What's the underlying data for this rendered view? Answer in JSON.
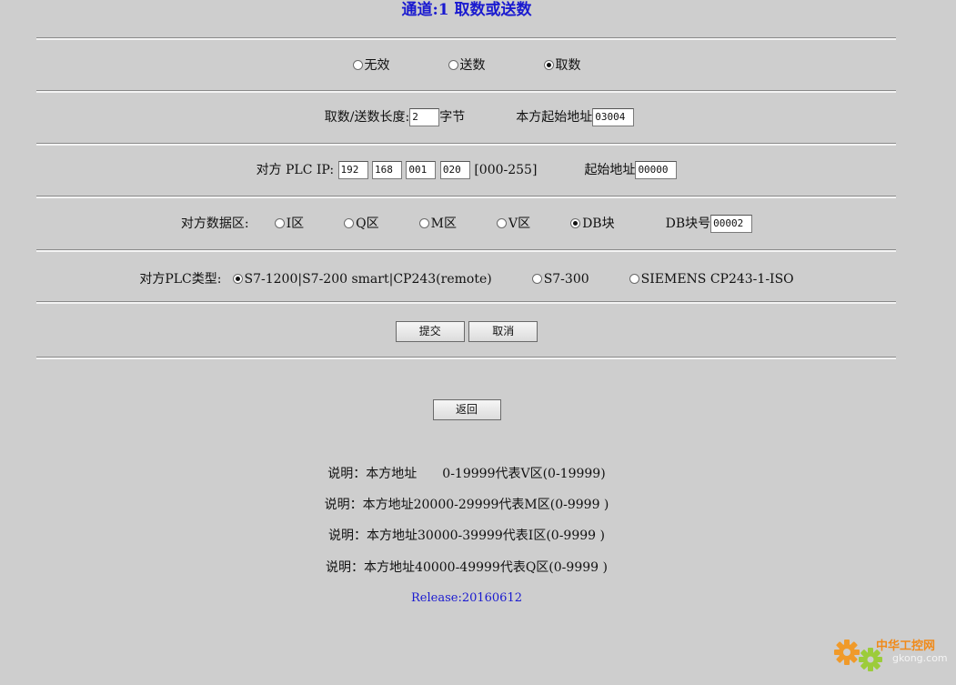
{
  "title": "通道:1 取数或送数",
  "mode": {
    "options": [
      "无效",
      "送数",
      "取数"
    ],
    "selected": "取数"
  },
  "length": {
    "label": "取数/送数长度:",
    "value": "2",
    "unit": "字节",
    "local_addr_label": "本方起始地址",
    "local_addr_value": "03004"
  },
  "ip": {
    "label": "对方 PLC IP:",
    "octets": [
      "192",
      "168",
      "001",
      "020"
    ],
    "range": "[000-255]",
    "start_addr_label": "起始地址",
    "start_addr_value": "00000"
  },
  "area": {
    "label": "对方数据区:",
    "options": [
      "I区",
      "Q区",
      "M区",
      "V区",
      "DB块"
    ],
    "selected": "DB块",
    "db_label": "DB块号",
    "db_value": "00002"
  },
  "plctype": {
    "label": "对方PLC类型:",
    "options": [
      "S7-1200|S7-200 smart|CP243(remote)",
      "S7-300",
      "SIEMENS CP243-1-ISO"
    ],
    "selected": "S7-1200|S7-200 smart|CP243(remote)"
  },
  "buttons": {
    "submit": "提交",
    "cancel": "取消",
    "back": "返回"
  },
  "notes": [
    "说明：本方地址　　0-19999代表V区(0-19999)",
    "说明：本方地址20000-29999代表M区(0-9999 )",
    "说明：本方地址30000-39999代表I区(0-9999 )",
    "说明：本方地址40000-49999代表Q区(0-9999 )"
  ],
  "release": "Release:20160612",
  "watermark": {
    "brand": "中华工控网",
    "domain": "gkong.com",
    "icon": "gear-icon"
  },
  "colors": {
    "title": "#1a1ad0",
    "background": "#cecece",
    "release": "#1a1ad0"
  }
}
